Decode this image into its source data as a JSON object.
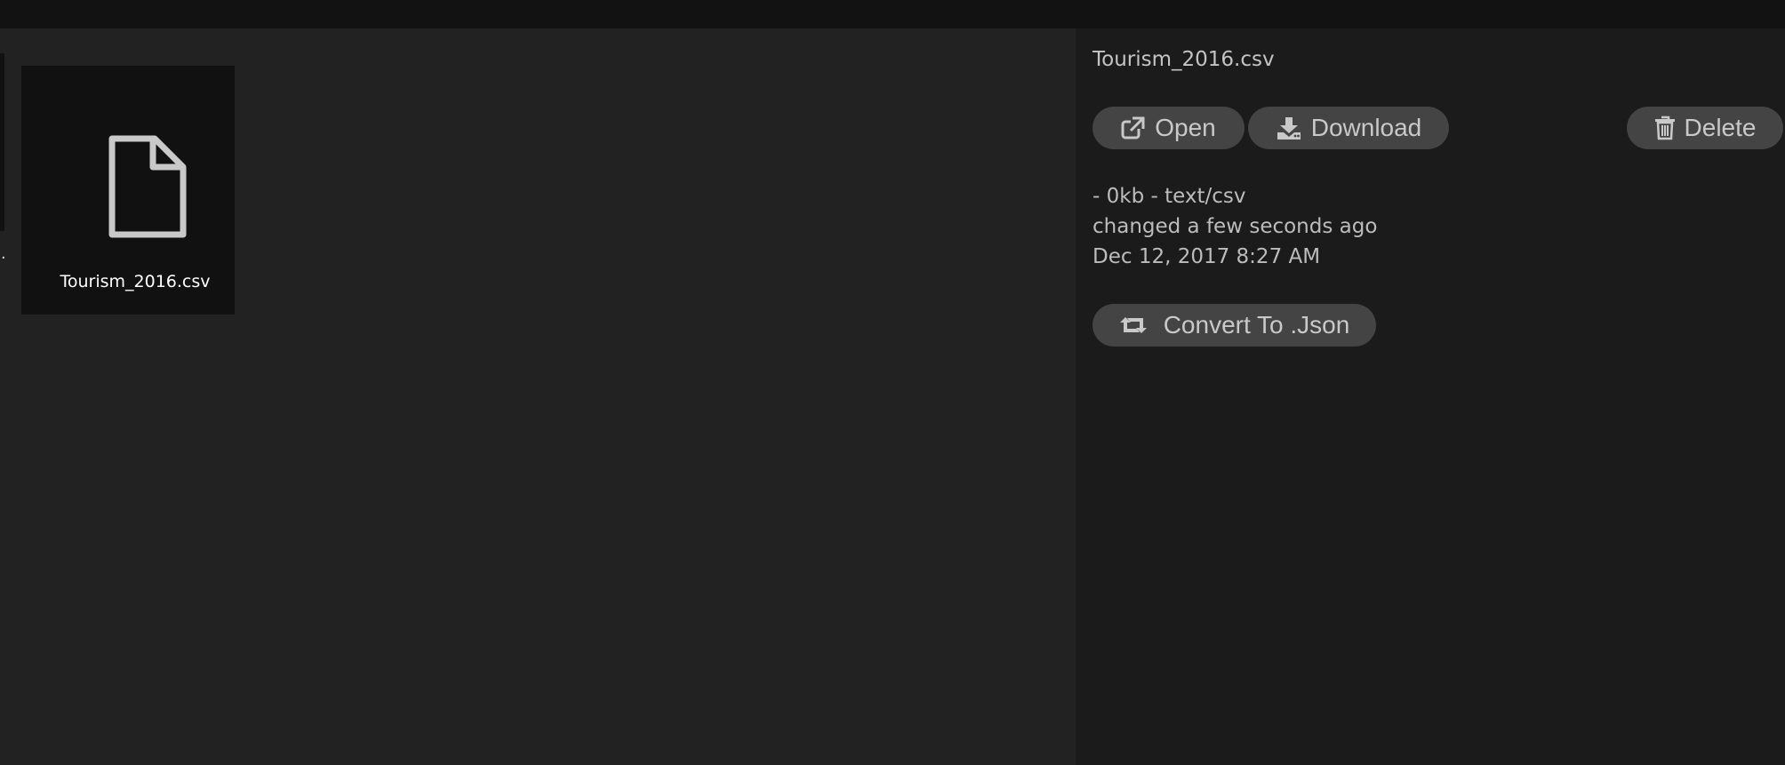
{
  "file_grid": {
    "partial_item_label": ".",
    "files": [
      {
        "name": "Tourism_2016.csv",
        "icon": "file-icon"
      }
    ]
  },
  "details": {
    "file_name": "Tourism_2016.csv",
    "actions": {
      "open_label": "Open",
      "download_label": "Download",
      "delete_label": "Delete",
      "convert_label": "Convert To .Json"
    },
    "meta": {
      "size_type": "- 0kb - text/csv",
      "changed": "changed a few seconds ago",
      "date": "Dec 12, 2017 8:27 AM"
    }
  },
  "icons": {
    "open": "external-link-icon",
    "download": "download-icon",
    "delete": "trash-icon",
    "convert": "retweet-icon"
  },
  "colors": {
    "background": "#222222",
    "panel": "#1b1b1b",
    "tile": "#111111",
    "button": "#444444"
  }
}
